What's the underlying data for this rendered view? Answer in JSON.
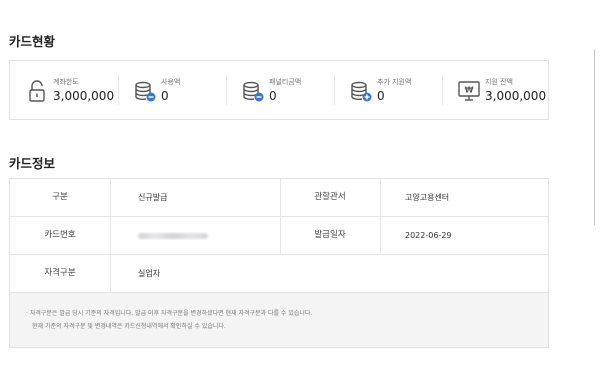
{
  "card_status": {
    "title": "카드현황",
    "items": [
      {
        "label": "계좌한도",
        "value": "3,000,000",
        "icon": "lock-icon"
      },
      {
        "label": "사용액",
        "value": "0",
        "icon": "coins-icon"
      },
      {
        "label": "패널티금액",
        "value": "0",
        "icon": "coins-icon"
      },
      {
        "label": "추가 지원액",
        "value": "0",
        "icon": "coins-icon"
      },
      {
        "label": "지원 잔액",
        "value": "3,000,000",
        "icon": "monitor-won-icon"
      }
    ]
  },
  "card_info": {
    "title": "카드정보",
    "rows": [
      {
        "label1": "구분",
        "value1": "신규발급",
        "label2": "관할관서",
        "value2": "고양고용센터"
      },
      {
        "label1": "카드번호",
        "value1": "",
        "label2": "발급일자",
        "value2": "2022-06-29"
      },
      {
        "label1": "자격구분",
        "value1": "실업자"
      }
    ],
    "notes": [
      "· 자격구분은 발급 당시 기준의 자격입니다. 발급 이후 자격구분을 변경하셨다면 현재 자격구분과 다를 수 있습니다.",
      "현재 기준의 자격구분 및 변경내역은 카드신청내역에서 확인하실 수 있습니다."
    ]
  }
}
